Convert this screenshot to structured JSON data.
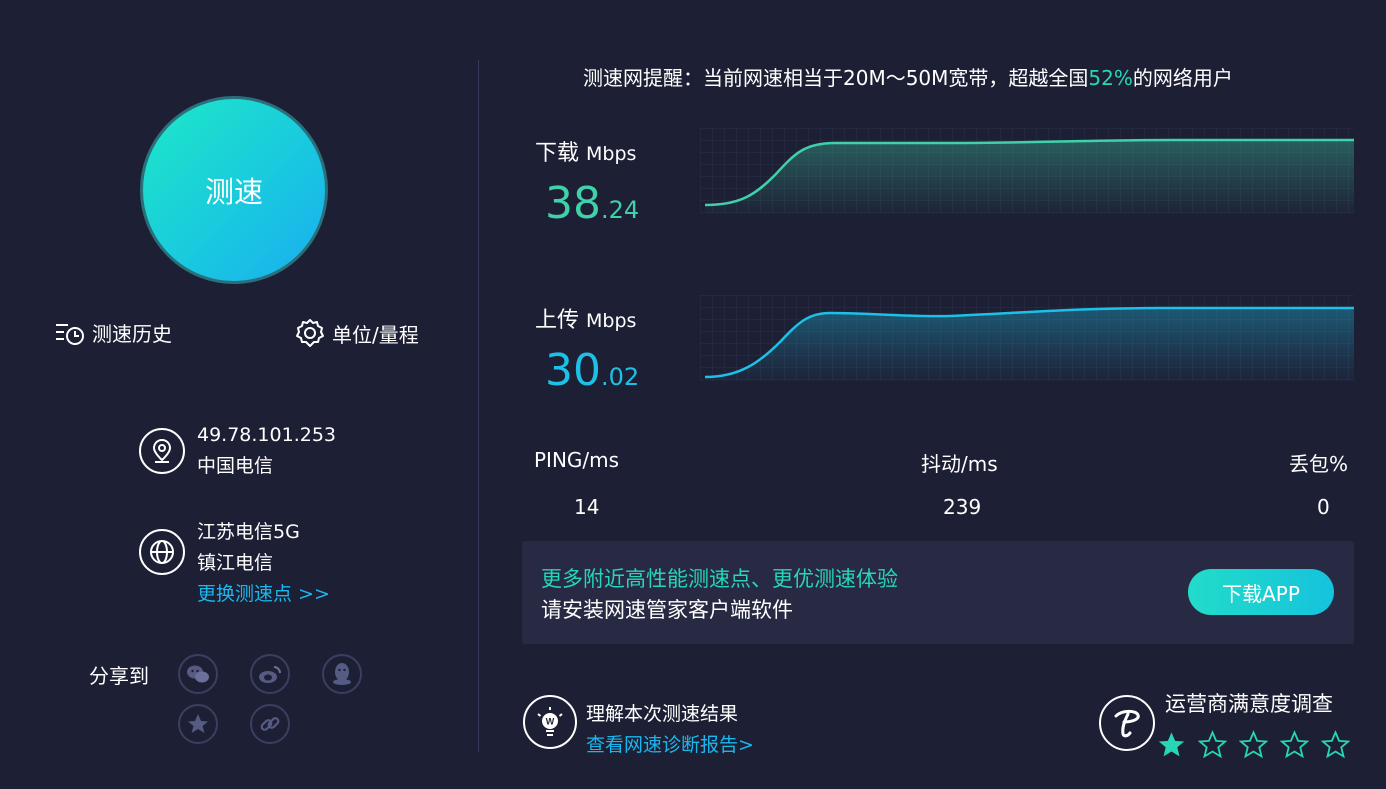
{
  "left": {
    "speed_button": "测速",
    "history_label": "测速历史",
    "unit_label": "单位/量程",
    "ip": "49.78.101.253",
    "isp": "中国电信",
    "server_name": "江苏电信5G",
    "server_city": "镇江电信",
    "change_server": "更换测速点 >>",
    "share_label": "分享到"
  },
  "notice": {
    "prefix": "测速网提醒：当前网速相当于20M～50M宽带，超越全国",
    "percent": "52%",
    "suffix": "的网络用户"
  },
  "download": {
    "label": "下载",
    "unit": "Mbps",
    "int": "38",
    "dec": ".24",
    "color": "#3fd1a9"
  },
  "upload": {
    "label": "上传",
    "unit": "Mbps",
    "int": "30",
    "dec": ".02",
    "color": "#1dc0e6"
  },
  "stats": {
    "ping_label": "PING/ms",
    "ping_value": "14",
    "jitter_label": "抖动/ms",
    "jitter_value": "239",
    "loss_label": "丢包%",
    "loss_value": "0"
  },
  "promo": {
    "line1": "更多附近高性能测速点、更优测速体验",
    "line2": "请安装网速管家客户端软件",
    "button": "下载APP"
  },
  "report": {
    "title": "理解本次测速结果",
    "link": "查看网速诊断报告>"
  },
  "survey": {
    "title": "运营商满意度调查",
    "rating": 1,
    "max": 5
  },
  "colors": {
    "accent_green": "#26d6b6",
    "accent_blue": "#1ab7ee",
    "background": "#1d2035"
  }
}
